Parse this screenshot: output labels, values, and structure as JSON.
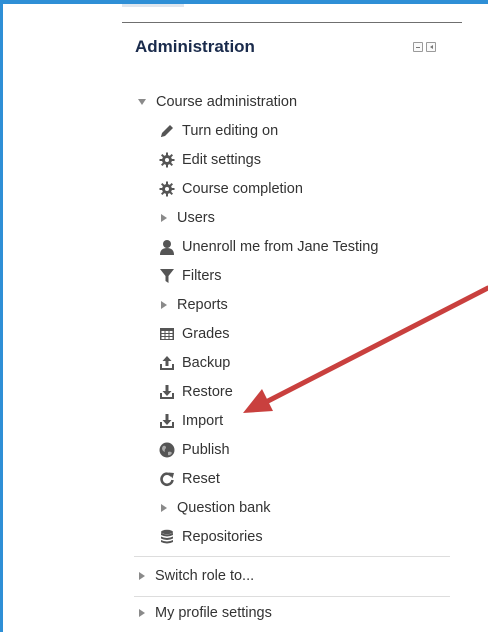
{
  "colors": {
    "title": "#1a2b4c",
    "accent_border": "#2e8fd6",
    "icon": "#555555",
    "arrow": "#c9403e"
  },
  "block": {
    "title": "Administration"
  },
  "course_admin": {
    "label": "Course administration",
    "items": [
      {
        "label": "Turn editing on",
        "icon": "pencil-icon"
      },
      {
        "label": "Edit settings",
        "icon": "gear-icon"
      },
      {
        "label": "Course completion",
        "icon": "gear-icon"
      },
      {
        "label": "Users",
        "icon": "expand-triangle"
      },
      {
        "label": "Unenroll me from Jane Testing",
        "icon": "user-icon"
      },
      {
        "label": "Filters",
        "icon": "filter-icon"
      },
      {
        "label": "Reports",
        "icon": "expand-triangle"
      },
      {
        "label": "Grades",
        "icon": "table-icon"
      },
      {
        "label": "Backup",
        "icon": "upload-icon"
      },
      {
        "label": "Restore",
        "icon": "download-icon"
      },
      {
        "label": "Import",
        "icon": "download-icon"
      },
      {
        "label": "Publish",
        "icon": "globe-icon"
      },
      {
        "label": "Reset",
        "icon": "refresh-icon"
      },
      {
        "label": "Question bank",
        "icon": "expand-triangle"
      },
      {
        "label": "Repositories",
        "icon": "database-icon"
      }
    ]
  },
  "switch_role": {
    "label": "Switch role to..."
  },
  "profile_settings": {
    "label": "My profile settings"
  }
}
